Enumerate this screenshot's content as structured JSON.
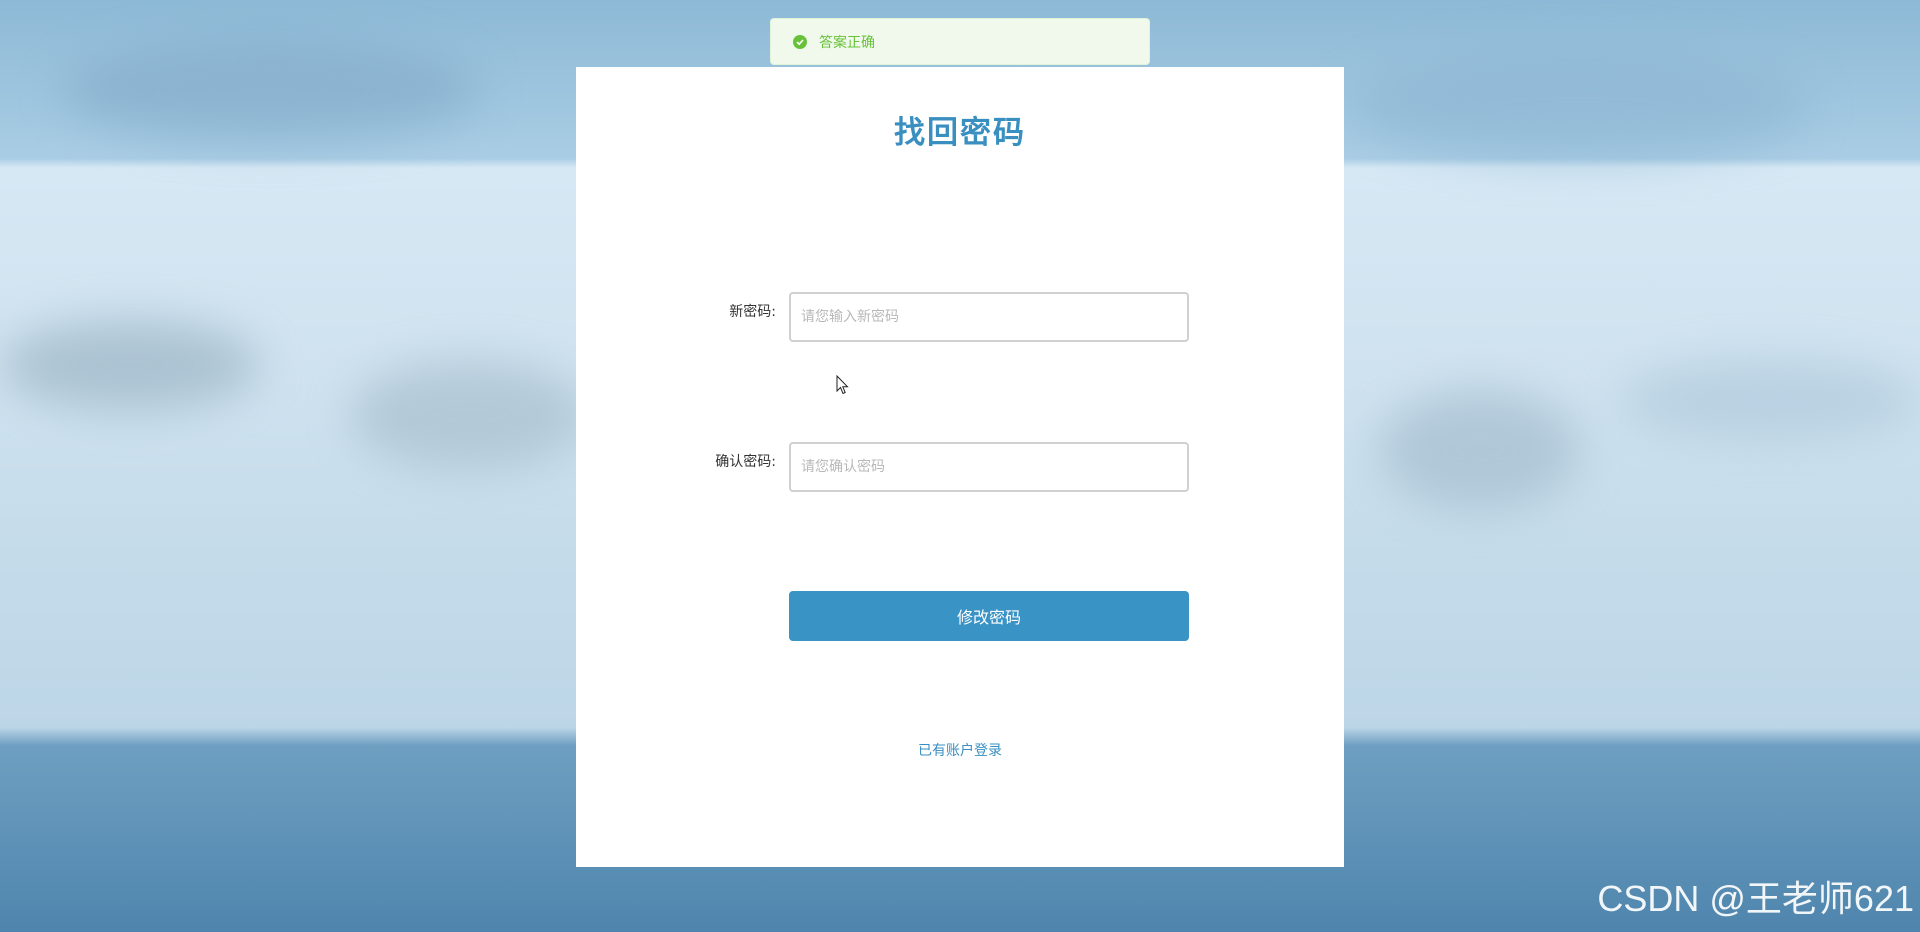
{
  "toast": {
    "message": "答案正确",
    "color": "#67c23a"
  },
  "form": {
    "title": "找回密码",
    "new_password_label": "新密码:",
    "new_password_placeholder": "请您输入新密码",
    "confirm_password_label": "确认密码:",
    "confirm_password_placeholder": "请您确认密码",
    "submit_label": "修改密码",
    "login_link": "已有账户登录"
  },
  "watermark": {
    "text": "CSDN @王老师621"
  },
  "colors": {
    "accent": "#3a93c5",
    "title": "#3a8fc1"
  }
}
